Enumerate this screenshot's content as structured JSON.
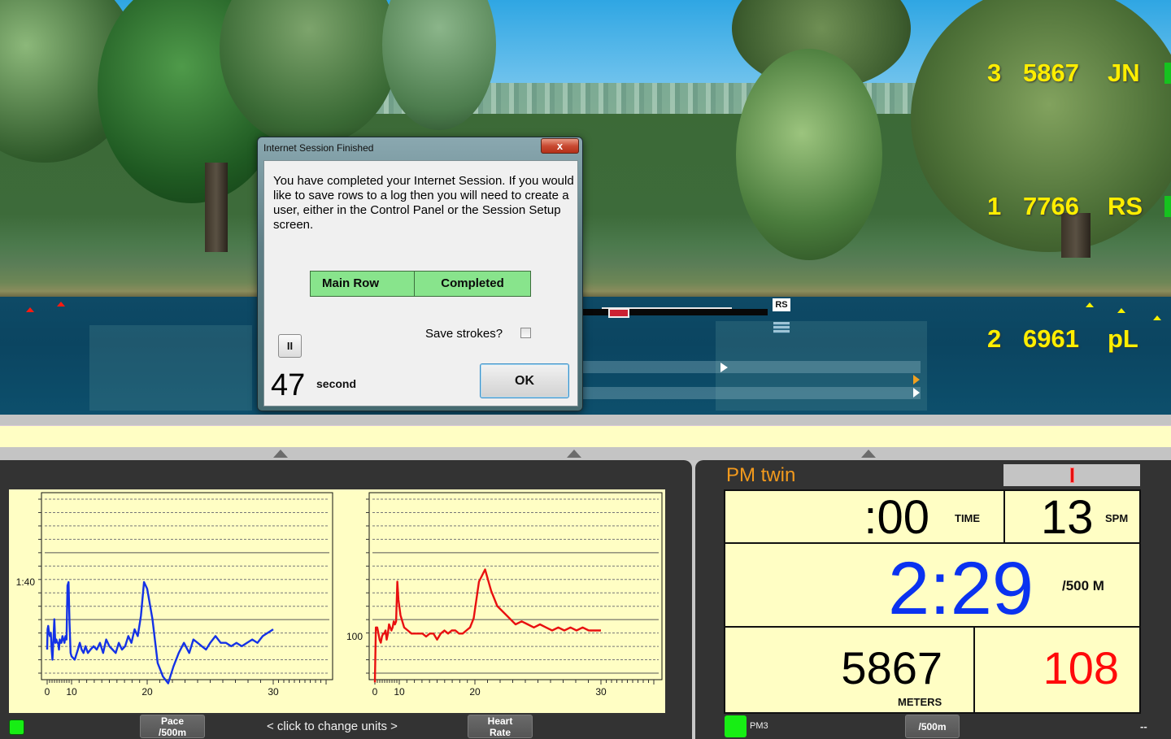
{
  "scene": {
    "leaderboard": [
      {
        "position": "3",
        "distance": "5867",
        "name": "JN"
      },
      {
        "position": "1",
        "distance": "7766",
        "name": "RS"
      },
      {
        "position": "2",
        "distance": "6961",
        "name": "pL"
      }
    ],
    "boat_tag": "RS"
  },
  "dialog": {
    "title": "Internet Session Finished",
    "close_label": "x",
    "message": "You have completed your Internet Session.  If you would like to save rows to a log then you will need to create a user, either in the Control Panel or the Session Setup screen.",
    "status_table": {
      "name": "Main Row",
      "status": "Completed"
    },
    "save_strokes_label": "Save strokes?",
    "save_strokes_checked": false,
    "pause_label": "II",
    "countdown_value": "47",
    "countdown_unit": "second",
    "ok_label": "OK"
  },
  "graph_panel": {
    "pace_button": "Pace /500m",
    "change_units_text": "<  click to change units  >",
    "hr_button": "Heart Rate"
  },
  "pm_panel": {
    "title": "PM twin",
    "force_curve_value": 0.5,
    "time_value": ":00",
    "time_label": "TIME",
    "spm_value": "13",
    "spm_label": "SPM",
    "pace_value": "2:29",
    "pace_label": "/500 M",
    "meters_value": "5867",
    "meters_label": "METERS",
    "heart_rate_value": "108",
    "monitor_name": "PM3",
    "unit_button": "/500m",
    "status_dash": "--"
  },
  "colors": {
    "pace_line": "#1432e6",
    "hr_line": "#e81010",
    "pace_big": "#0a32f0",
    "hr_big": "#ff0a0a",
    "pm_title": "#f39a1d",
    "panel_bg": "#fffec4"
  },
  "chart_data": [
    {
      "type": "line",
      "title": "Pace /500m",
      "xlabel": "",
      "ylabel": "",
      "x_ticks": [
        "0",
        "10",
        "20",
        "30"
      ],
      "y_ticks": [
        "1:40"
      ],
      "y_axis_inverted": true,
      "grid": true,
      "series": [
        {
          "name": "Pace /500m",
          "x": [
            0,
            0.2,
            0.5,
            0.9,
            1.3,
            1.8,
            2.2,
            2.6,
            3.0,
            3.5,
            4.0,
            4.5,
            5.0,
            5.4,
            5.8,
            6.2,
            6.6,
            7.0,
            7.5,
            8.0,
            8.5,
            9.0,
            9.5,
            10.0,
            10.5,
            11.0,
            11.5,
            12.0,
            12.5,
            13.0,
            13.3,
            13.6,
            13.9,
            14.2,
            14.6,
            15.0,
            15.5,
            16.0,
            16.5,
            17.0,
            17.5,
            18.0,
            18.5,
            19.0,
            19.5,
            20.0,
            20.5,
            21.0,
            21.5,
            22.0,
            22.5,
            23.0,
            23.5,
            24.0,
            24.5,
            25.0,
            25.5,
            26.0,
            26.5,
            27.0,
            27.5,
            28.0,
            28.4,
            28.8,
            29.2,
            29.6,
            30.0,
            30.5,
            31.0,
            31.5,
            32.0,
            32.5,
            33.0,
            33.5,
            34.0,
            34.5,
            35.0,
            35.5,
            36.0
          ],
          "values_sec": [
            120,
            114,
            113,
            115,
            116,
            115,
            120,
            123,
            118,
            111,
            118,
            117,
            118,
            118,
            120,
            117,
            118,
            118,
            116,
            117,
            118,
            116,
            117,
            101,
            100,
            112,
            121,
            122,
            123,
            120,
            118,
            120,
            121,
            119,
            121,
            120,
            119,
            120,
            118,
            121,
            117,
            119,
            120,
            121,
            118,
            120,
            119,
            116,
            118,
            114,
            116,
            110,
            100,
            102,
            111,
            124,
            128,
            130,
            125,
            121,
            118,
            121,
            117,
            118,
            119,
            120,
            118,
            116,
            118,
            118,
            119,
            118,
            119,
            118,
            117,
            118,
            116,
            115,
            114
          ]
        }
      ]
    },
    {
      "type": "line",
      "title": "Heart Rate",
      "xlabel": "",
      "ylabel": "",
      "x_ticks": [
        "0",
        "10",
        "20",
        "30"
      ],
      "y_ticks": [
        "100"
      ],
      "grid": true,
      "series": [
        {
          "name": "Heart Rate",
          "x": [
            0,
            0.2,
            0.4,
            0.6,
            1.0,
            1.5,
            2.0,
            2.5,
            3.0,
            3.5,
            4.0,
            4.5,
            5.0,
            5.5,
            6.0,
            6.5,
            7.0,
            7.5,
            8.0,
            8.5,
            9.0,
            9.5,
            10.0,
            10.5,
            11.0,
            11.5,
            12.0,
            12.5,
            13.0,
            13.5,
            14.0,
            14.5,
            15.0,
            15.5,
            16.0,
            16.5,
            17.0,
            17.5,
            18.0,
            18.5,
            19.0,
            19.5,
            20.0,
            20.5,
            21.0,
            21.5,
            22.0,
            22.5,
            23.0,
            23.5,
            24.0,
            24.5,
            25.0,
            25.5,
            26.0,
            26.5,
            27.0,
            27.5,
            28.0,
            28.5,
            29.0,
            29.5,
            30.0,
            30.5,
            31.0
          ],
          "values": [
            85,
            94,
            103,
            103,
            103,
            101,
            99,
            98,
            100,
            101,
            101,
            102,
            99,
            101,
            104,
            103,
            102,
            103,
            105,
            104,
            105,
            118,
            112,
            107,
            103,
            102,
            101,
            101,
            101,
            101,
            100,
            101,
            101,
            99,
            101,
            102,
            101,
            102,
            102,
            101,
            101,
            102,
            103,
            106,
            118,
            122,
            115,
            110,
            108,
            106,
            104,
            105,
            104,
            103,
            104,
            103,
            102,
            103,
            102,
            103,
            102,
            103,
            102,
            102,
            102
          ]
        }
      ]
    }
  ]
}
